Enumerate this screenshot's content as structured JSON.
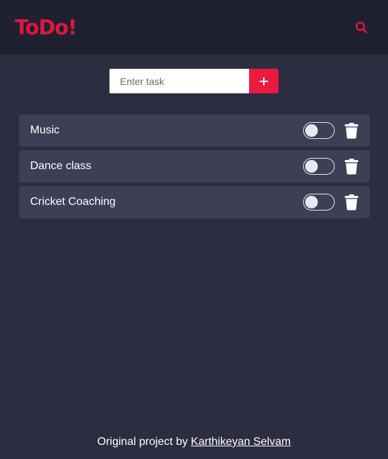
{
  "header": {
    "logo": "ToDo!",
    "search_icon": "search-icon",
    "accent_color": "#e0153f"
  },
  "add_form": {
    "placeholder": "Enter task",
    "value": "",
    "add_icon": "plus-icon",
    "button_color": "#ec1a3f"
  },
  "tasks": [
    {
      "label": "Music",
      "completed": false,
      "delete_icon": "trash-icon"
    },
    {
      "label": "Dance class",
      "completed": false,
      "delete_icon": "trash-icon"
    },
    {
      "label": "Cricket Coaching",
      "completed": false,
      "delete_icon": "trash-icon"
    }
  ],
  "footer": {
    "prefix": "Original project by",
    "author": "Karthikeyan Selvam"
  },
  "colors": {
    "background": "#2c2d40",
    "header_bg": "#1f2030",
    "task_bg": "#3d3f54"
  }
}
